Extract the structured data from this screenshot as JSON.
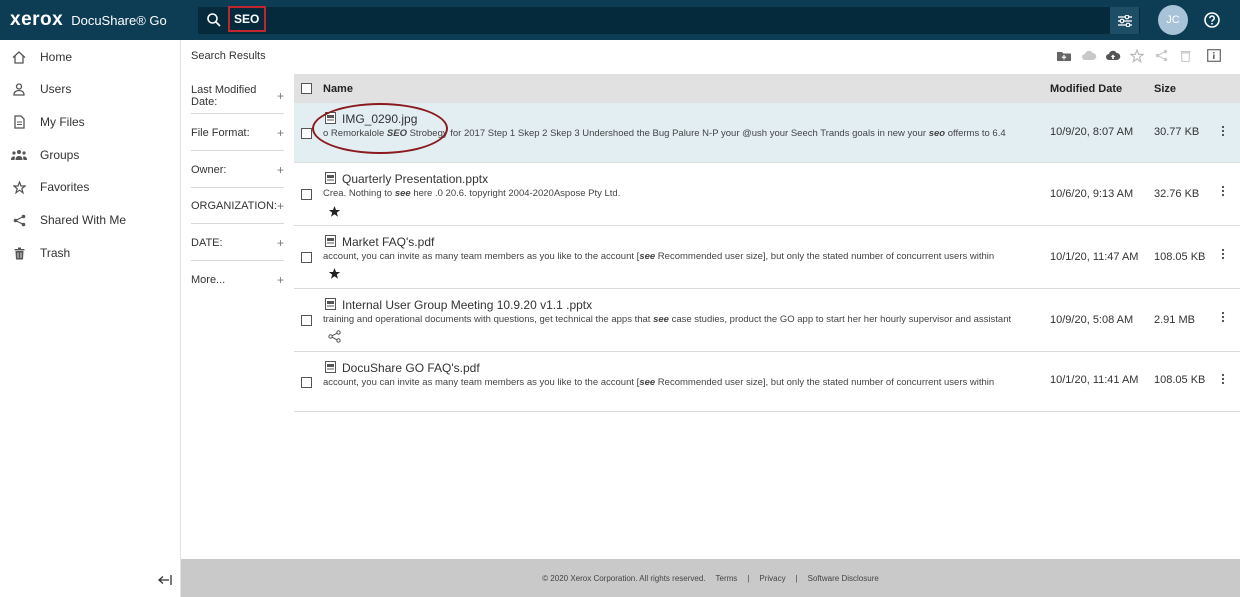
{
  "header": {
    "logo": "xerox",
    "product": "DocuShare® Go",
    "search_value": "SEO",
    "user_initials": "JC"
  },
  "sidebar": {
    "items": [
      {
        "label": "Home",
        "icon": "home-icon"
      },
      {
        "label": "Users",
        "icon": "user-icon"
      },
      {
        "label": "My Files",
        "icon": "file-icon"
      },
      {
        "label": "Groups",
        "icon": "groups-icon"
      },
      {
        "label": "Favorites",
        "icon": "star-icon"
      },
      {
        "label": "Shared With Me",
        "icon": "share-icon"
      },
      {
        "label": "Trash",
        "icon": "trash-icon"
      }
    ]
  },
  "results": {
    "title": "Search Results",
    "filters": [
      "Last Modified Date:",
      "File Format:",
      "Owner:",
      "ORGANIZATION:",
      "DATE:",
      "More..."
    ],
    "columns": {
      "name": "Name",
      "modified": "Modified Date",
      "size": "Size"
    },
    "rows": [
      {
        "name": "IMG_0290.jpg",
        "snippet_parts": [
          "o Remorkalole ",
          "SEO",
          " Strobegy for 2017 Step 1 Skep 2 Skep 3 Undershoed the Bug Palure N-P your @ush your Seech Trands goals in new your ",
          "seo",
          " offerms to 6.4"
        ],
        "modified": "10/9/20, 8:07 AM",
        "size": "30.77 KB",
        "mark": ""
      },
      {
        "name": "Quarterly Presentation.pptx",
        "snippet_parts": [
          "Crea. Nothing to ",
          "see",
          " here .0 20.6. topyright 2004-2020Aspose Pty Ltd.",
          "",
          ""
        ],
        "modified": "10/6/20, 9:13 AM",
        "size": "32.76 KB",
        "mark": "star"
      },
      {
        "name": "Market FAQ's.pdf",
        "snippet_parts": [
          "account, you can invite as many team members as you like to the account [",
          "see",
          " Recommended user size], but only the stated number of concurrent users within",
          "",
          ""
        ],
        "modified": "10/1/20, 11:47 AM",
        "size": "108.05 KB",
        "mark": "star"
      },
      {
        "name": "Internal User Group Meeting 10.9.20 v1.1 .pptx",
        "snippet_parts": [
          "training and operational documents with questions, get technical the apps that ",
          "see",
          " case studies, product the GO app to start her her hourly supervisor and assistant",
          "",
          ""
        ],
        "modified": "10/9/20, 5:08 AM",
        "size": "2.91 MB",
        "mark": "share"
      },
      {
        "name": "DocuShare GO FAQ's.pdf",
        "snippet_parts": [
          "account, you can invite as many team members as you like to the account [",
          "see",
          " Recommended user size], but only the stated number of concurrent users within",
          "",
          ""
        ],
        "modified": "10/1/20, 11:41 AM",
        "size": "108.05 KB",
        "mark": ""
      }
    ]
  },
  "footer": {
    "copyright": "© 2020 Xerox Corporation. All rights reserved.",
    "terms": "Terms",
    "privacy": "Privacy",
    "disclosure": "Software Disclosure",
    "sep": "|"
  },
  "colors": {
    "topbar": "#0c3d55",
    "highlight_row": "#e3eef3",
    "search_outline": "#c0262d",
    "annotation": "#8a1a1e"
  }
}
